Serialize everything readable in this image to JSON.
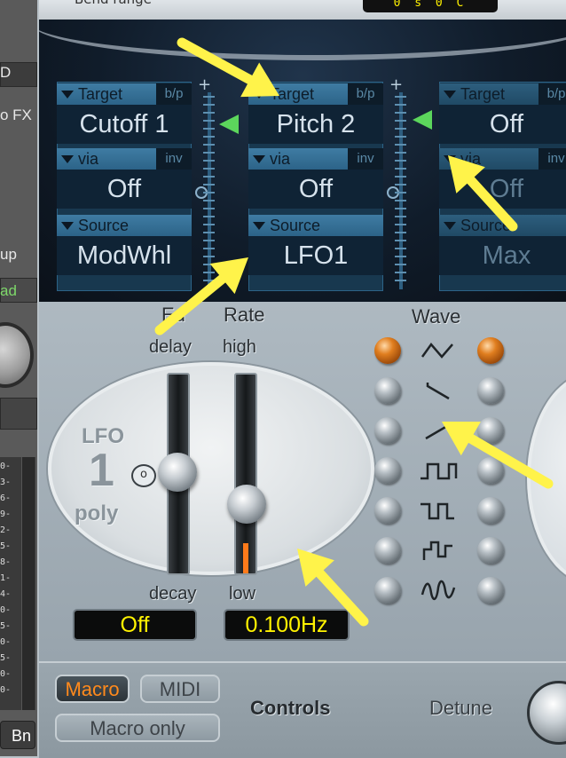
{
  "host": {
    "row_labels": [
      "D",
      "o FX",
      "up",
      "ad"
    ],
    "meter_ticks": [
      "0",
      "3",
      "6",
      "9",
      "2",
      "5",
      "8",
      "1",
      "4",
      "0",
      "5",
      "0",
      "5",
      "0",
      "0"
    ],
    "bottom_label": "Bn"
  },
  "top": {
    "bend_label": "Bend range",
    "bend_readout": "0 s   0 C"
  },
  "mod_matrix": {
    "slots": [
      {
        "target_header": "Target",
        "bp_tag": "b/p",
        "target": "Cutoff 1",
        "via_header": "via",
        "inv_tag": "inv",
        "via": "Off",
        "source_header": "Source",
        "source": "ModWhl"
      },
      {
        "target_header": "Target",
        "bp_tag": "b/p",
        "target": "Pitch 2",
        "via_header": "via",
        "inv_tag": "inv",
        "via": "Off",
        "source_header": "Source",
        "source": "LFO1"
      },
      {
        "target_header": "Target",
        "bp_tag": "b/p",
        "target": "Off",
        "via_header": "via",
        "inv_tag": "inv",
        "via": "Off",
        "source_header": "Source",
        "source": "Max"
      }
    ],
    "fader_plus": "+",
    "fader_zero": "o",
    "amount_color": "#5cd65c"
  },
  "lfo": {
    "engraved_lfo": "LFO",
    "engraved_number": "1",
    "engraved_poly": "poly",
    "ed_label": "Ed",
    "delay_label": "delay",
    "rate_label": "Rate",
    "high_label": "high",
    "decay_label": "decay",
    "low_label": "low",
    "sync_glyph": "o",
    "ed_readout": "Off",
    "rate_readout": "0.100Hz",
    "ed_level": 0.5,
    "rate_level": 0.3,
    "wave_label": "Wave",
    "led_on_color": "#e07e1f",
    "waveforms": [
      "triangle-wave-icon",
      "sawtooth-down-wave-icon",
      "sawtooth-up-wave-icon",
      "square-wave-icon",
      "pulse-wave-icon",
      "sample-hold-wave-icon",
      "smooth-random-wave-icon"
    ],
    "selected_left": 0,
    "selected_right": 0
  },
  "bottom": {
    "macro_label": "Macro",
    "midi_label": "MIDI",
    "macro_only_label": "Macro only",
    "controls_label": "Controls",
    "detune_label": "Detune"
  },
  "annotation_color": "#fff34a"
}
